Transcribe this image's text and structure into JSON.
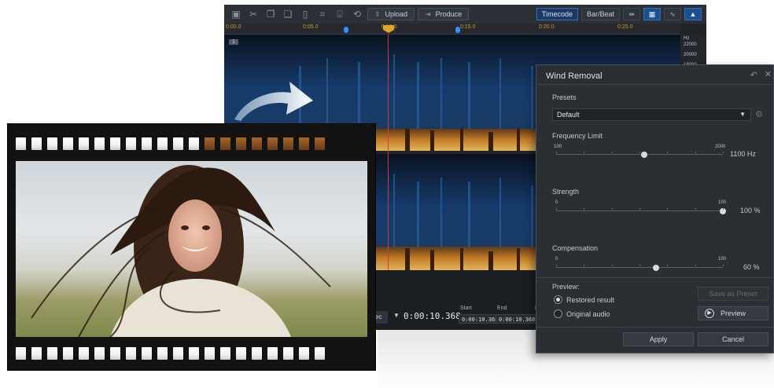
{
  "toolbar": {
    "upload_label": "Upload",
    "produce_label": "Produce",
    "timecode_label": "Timecode",
    "barbeat_label": "Bar/Beat",
    "icons": [
      "library-icon",
      "cut-icon",
      "copy-icon",
      "paste-icon",
      "delete-icon",
      "crop-icon",
      "mark-icon",
      "undo-icon",
      "upload-icon",
      "produce-icon",
      "snap-icon",
      "grid-icon",
      "waveform-icon",
      "spectrum-icon"
    ]
  },
  "ruler": {
    "ticks": [
      "0:00.0",
      "0:05.0",
      "0:10.0",
      "0:15.0",
      "0:20.0",
      "0:25.0"
    ]
  },
  "hz_scale": {
    "unit": "Hz",
    "labels": [
      "22000",
      "20000",
      "18000"
    ]
  },
  "spectrogram": {
    "track_label": "1"
  },
  "timecode": {
    "format_suffix": "dec",
    "current": "0:00:10.368",
    "start_label": "Start",
    "end_label": "End",
    "length_label": "L",
    "start": "0:00:10.368",
    "end": "0:00:10.368"
  },
  "dialog": {
    "title": "Wind Removal",
    "presets_label": "Presets",
    "preset_value": "Default",
    "sliders": [
      {
        "label": "Frequency Limit",
        "min": "100",
        "max": "2000",
        "value": 1100,
        "value_text": "1100 Hz",
        "min_num": 100,
        "max_num": 2000
      },
      {
        "label": "Strength",
        "min": "0",
        "max": "100",
        "value": 100,
        "value_text": "100 %",
        "min_num": 0,
        "max_num": 100
      },
      {
        "label": "Compensation",
        "min": "0",
        "max": "100",
        "value": 60,
        "value_text": "60 %",
        "min_num": 0,
        "max_num": 100
      }
    ],
    "preview_label": "Preview:",
    "radio_restored": "Restored result",
    "radio_original": "Original audio",
    "save_preset": "Save as Preset",
    "preview_button": "Preview",
    "apply_button": "Apply",
    "cancel_button": "Cancel"
  },
  "colors": {
    "accent_blue": "#2f6fb8",
    "playhead": "#d13b3b",
    "ruler_text": "#c99a2e"
  }
}
